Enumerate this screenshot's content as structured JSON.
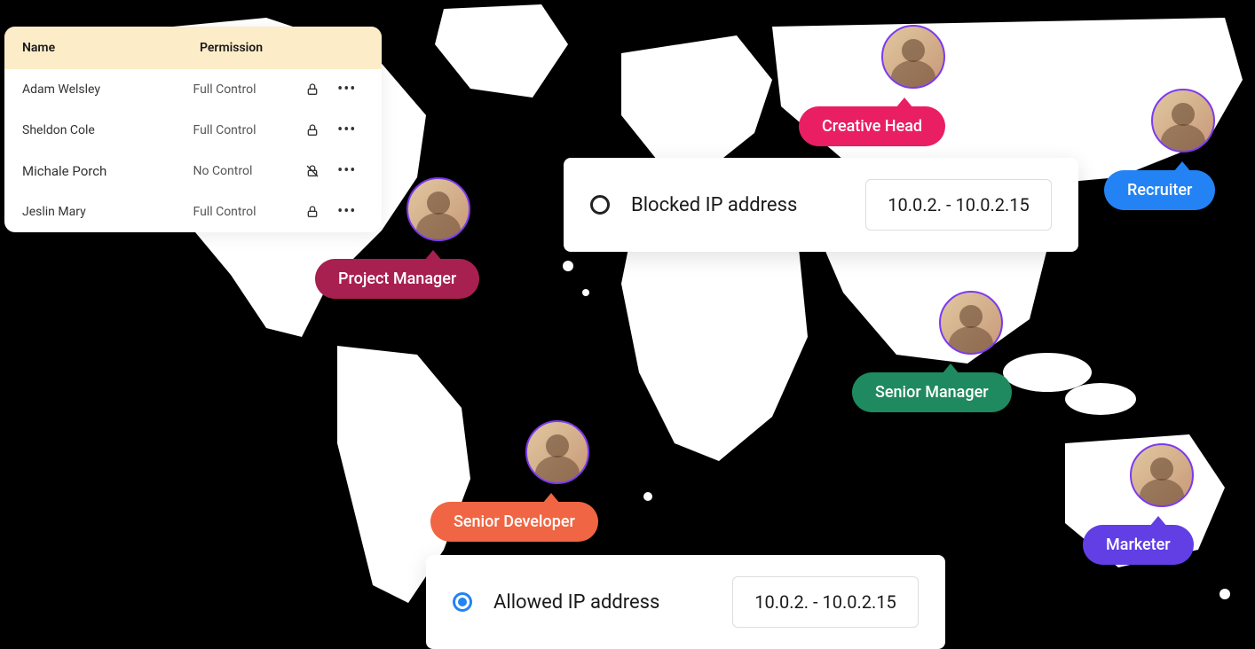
{
  "permissions": {
    "headers": {
      "name": "Name",
      "permission": "Permission"
    },
    "rows": [
      {
        "name": "Adam Welsley",
        "permission": "Full Control",
        "locked": true
      },
      {
        "name": "Sheldon Cole",
        "permission": "Full Control",
        "locked": true
      },
      {
        "name": "Michale Porch",
        "permission": "No Control",
        "locked": false
      },
      {
        "name": "Jeslin Mary",
        "permission": "Full Control",
        "locked": true
      }
    ]
  },
  "ip": {
    "blocked": {
      "label": "Blocked IP address",
      "value": "10.0.2. - 10.0.2.15",
      "selected": false
    },
    "allowed": {
      "label": "Allowed IP address",
      "value": "10.0.2. - 10.0.2.15",
      "selected": true
    }
  },
  "people": {
    "project_manager": {
      "role": "Project Manager"
    },
    "senior_developer": {
      "role": "Senior Developer"
    },
    "creative_head": {
      "role": "Creative Head"
    },
    "recruiter": {
      "role": "Recruiter"
    },
    "senior_manager": {
      "role": "Senior Manager"
    },
    "marketer": {
      "role": "Marketer"
    }
  }
}
